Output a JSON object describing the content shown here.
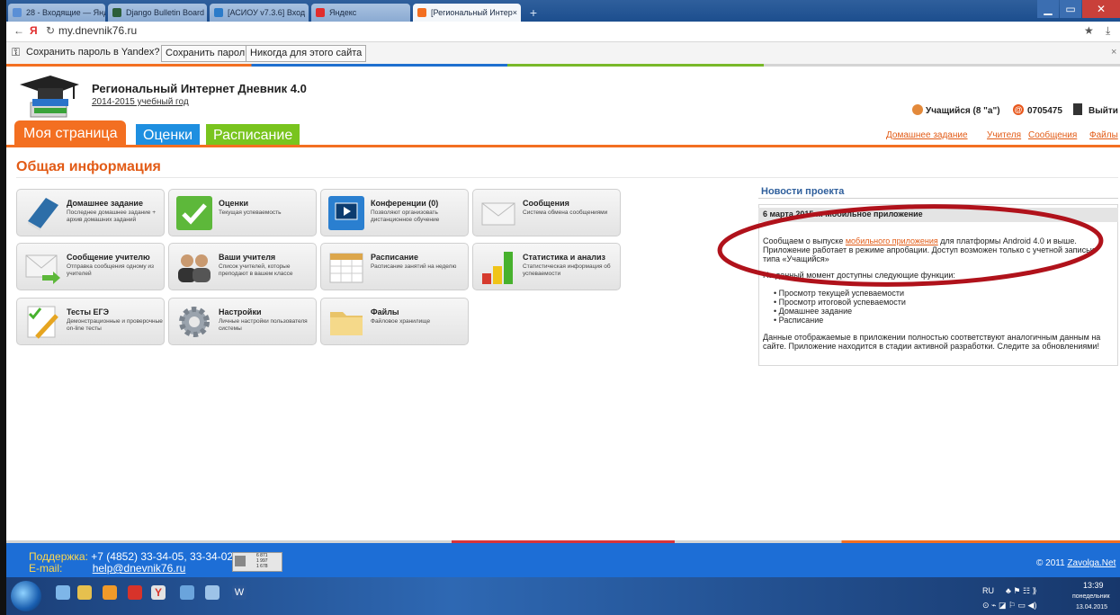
{
  "browser": {
    "tabs": [
      {
        "label": "28 - Входящие — Янде"
      },
      {
        "label": "Django Bulletin Board"
      },
      {
        "label": "[АСИОУ v7.3.6] Вход"
      },
      {
        "label": "Яндекс"
      },
      {
        "label": "[Региональный Интер"
      }
    ],
    "address": "my.dnevnik76.ru",
    "yandex_logo": "Я"
  },
  "password_bar": {
    "question": "Сохранить пароль в Yandex?",
    "save": "Сохранить пароль",
    "never": "Никогда для этого сайта"
  },
  "header": {
    "title": "Региональный Интернет Дневник 4.0",
    "year": "2014-2015 учебный год",
    "user": "Учащийся (8 \"а\")",
    "id": "0705475",
    "logout": "Выйти"
  },
  "nav": {
    "tabs": [
      "Моя страница",
      "Оценки",
      "Расписание"
    ],
    "links": [
      "Домашнее задание",
      "Учителя",
      "Сообщения",
      "Файлы"
    ]
  },
  "section_title": "Общая информация",
  "tiles": [
    {
      "title": "Домашнее задание",
      "desc": "Последнее домашнее задание + архив домашних заданий"
    },
    {
      "title": "Оценки",
      "desc": "Текущая успеваемость"
    },
    {
      "title": "Конференции (0)",
      "desc": "Позволяют организовать дистанционное обучение"
    },
    {
      "title": "Сообщения",
      "desc": "Система обмена сообщениями"
    },
    {
      "title": "Сообщение учителю",
      "desc": "Отправка сообщения одному из учителей"
    },
    {
      "title": "Ваши учителя",
      "desc": "Список учителей, которые преподают в вашем классе"
    },
    {
      "title": "Расписание",
      "desc": "Расписание занятий на неделю"
    },
    {
      "title": "Статистика и анализ",
      "desc": "Статистическая информация об успеваемости"
    },
    {
      "title": "Тесты ЕГЭ",
      "desc": "Демонстрационные и проверочные on-line тесты"
    },
    {
      "title": "Настройки",
      "desc": "Личные настройки пользователя системы"
    },
    {
      "title": "Файлы",
      "desc": "Файловое хранилище"
    }
  ],
  "news": {
    "title": "Новости проекта",
    "date": "6 марта 2015 г.. Мобильное приложение",
    "p1_before": "Сообщаем о выпуске ",
    "p1_link": "мобильного приложения",
    "p1_after": " для платформы Android 4.0 и выше. Приложение работает в режиме апробации. Доступ возможен только с учетной записью типа «Учащийся»",
    "p2": "На данный момент доступны следующие функции:",
    "items": [
      "Просмотр текущей успеваемости",
      "Просмотр итоговой успеваемости",
      "Домашнее задание",
      "Расписание"
    ],
    "p3": "Данные отображаемые в приложении полностью соответствуют аналогичным данным на сайте. Приложение находится в стадии активной разработки. Следите за обновлениями!"
  },
  "footer": {
    "support_label": "Поддержка:",
    "support_phones": "+7 (4852) 33-34-05, 33-34-02",
    "email_label": "E-mail:",
    "email": "help@dnevnik76.ru",
    "counter": [
      "6 871",
      "1 997",
      "1 678"
    ],
    "copyright": "© 2011",
    "copyright_link": "Zavolga.Net"
  },
  "taskbar": {
    "lang": "RU",
    "time": "13:39",
    "day": "понедельник",
    "date": "13.04.2015"
  },
  "colors": {
    "orange": "#f36f21",
    "blue": "#1e6fcf",
    "green": "#79b829",
    "footer": "#1d6ed6",
    "oval": "#b0121b"
  }
}
